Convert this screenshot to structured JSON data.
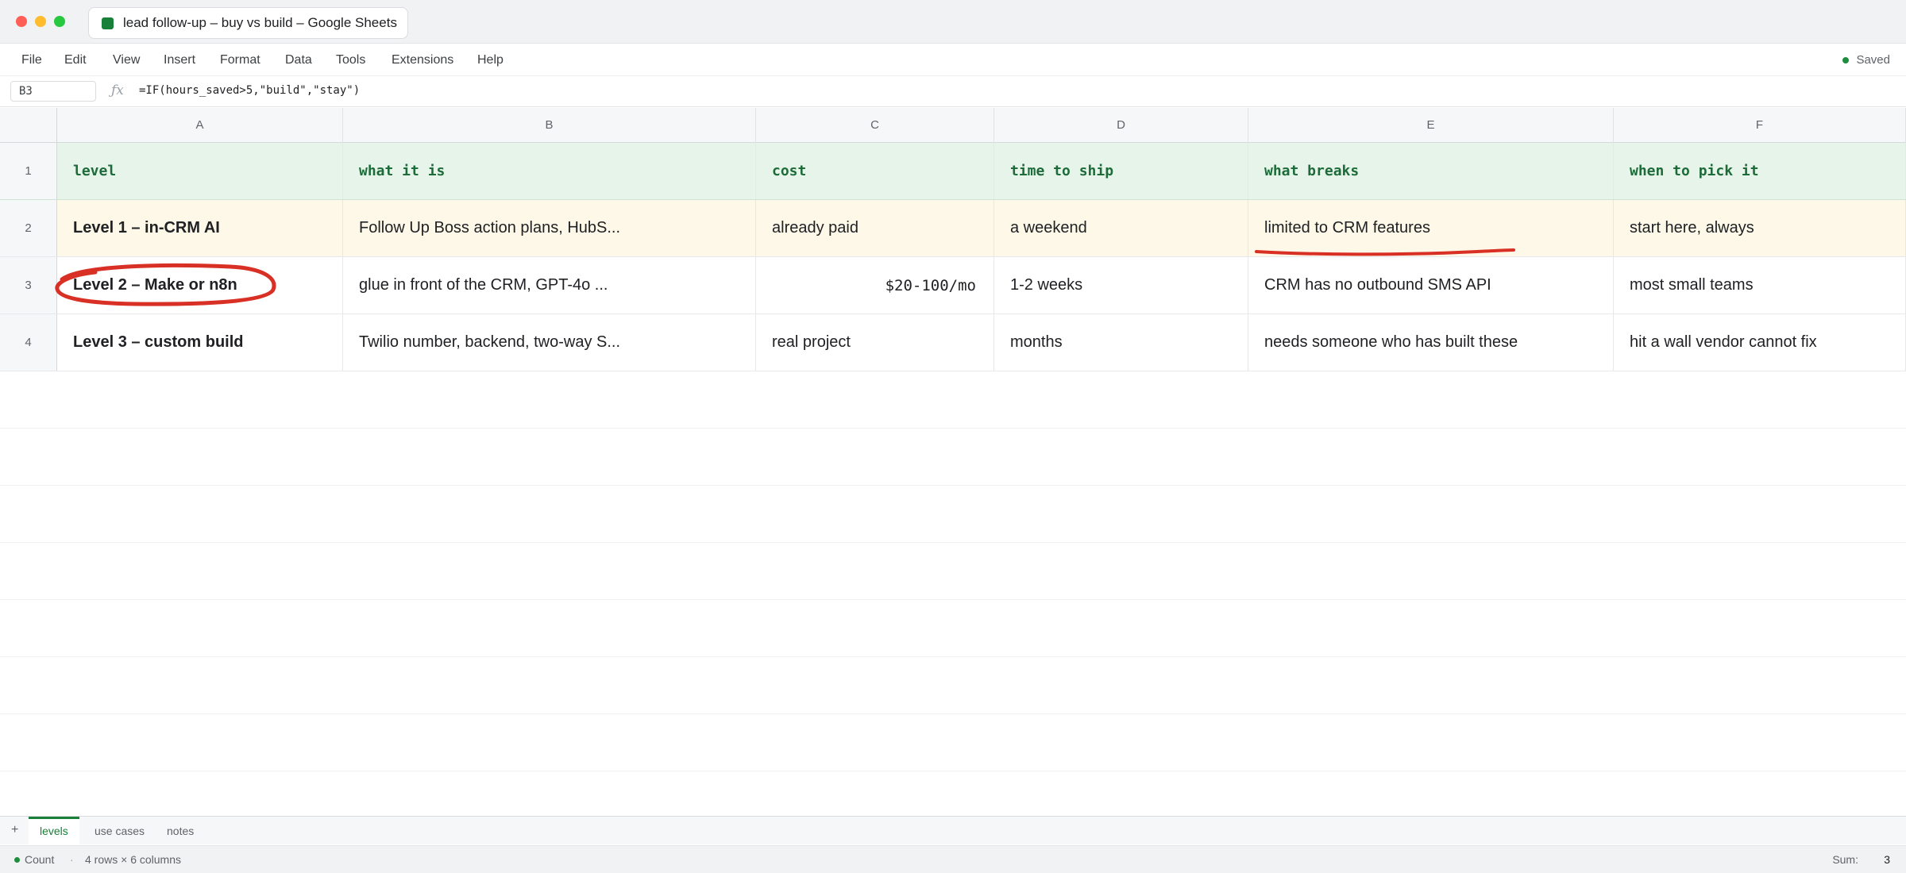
{
  "window": {
    "tab_title": "lead follow-up – buy vs build – Google Sheets"
  },
  "menu": {
    "items": [
      "File",
      "Edit",
      "View",
      "Insert",
      "Format",
      "Data",
      "Tools",
      "Extensions",
      "Help"
    ],
    "status": "Saved"
  },
  "formula_bar": {
    "cell_ref": "B3",
    "fx": "ƒx",
    "formula": "=IF(hours_saved>5,\"build\",\"stay\")"
  },
  "grid": {
    "columns": [
      "A",
      "B",
      "C",
      "D",
      "E",
      "F"
    ],
    "rows": [
      {
        "num": "1",
        "cells": [
          "level",
          "what it is",
          "cost",
          "time to ship",
          "what breaks",
          "when to pick it"
        ]
      },
      {
        "num": "2",
        "cells": [
          "Level 1 – in-CRM AI",
          "Follow Up Boss action plans, HubS...",
          "already paid",
          "a weekend",
          "limited to CRM features",
          "start here, always"
        ]
      },
      {
        "num": "3",
        "cells": [
          "Level 2 – Make or n8n",
          "glue in front of the CRM, GPT-4o ...",
          "$20-100/mo",
          "1-2 weeks",
          "CRM has no outbound SMS API",
          "most small teams"
        ]
      },
      {
        "num": "4",
        "cells": [
          "Level 3 – custom build",
          "Twilio number, backend, two-way S...",
          "real project",
          "months",
          "needs someone who has built these",
          "hit a wall vendor cannot fix"
        ]
      }
    ],
    "highlight_color": "#fdf8e7",
    "header_color": "#e6f4ea",
    "annotation_color": "#d93025"
  },
  "sheets": {
    "add": "+",
    "tabs": [
      "levels",
      "use cases",
      "notes"
    ],
    "active": "levels"
  },
  "status": {
    "count_label": "Count",
    "separator": "·",
    "dims": "4 rows × 6 columns",
    "sum_label": "Sum:",
    "sum_value": "3"
  }
}
